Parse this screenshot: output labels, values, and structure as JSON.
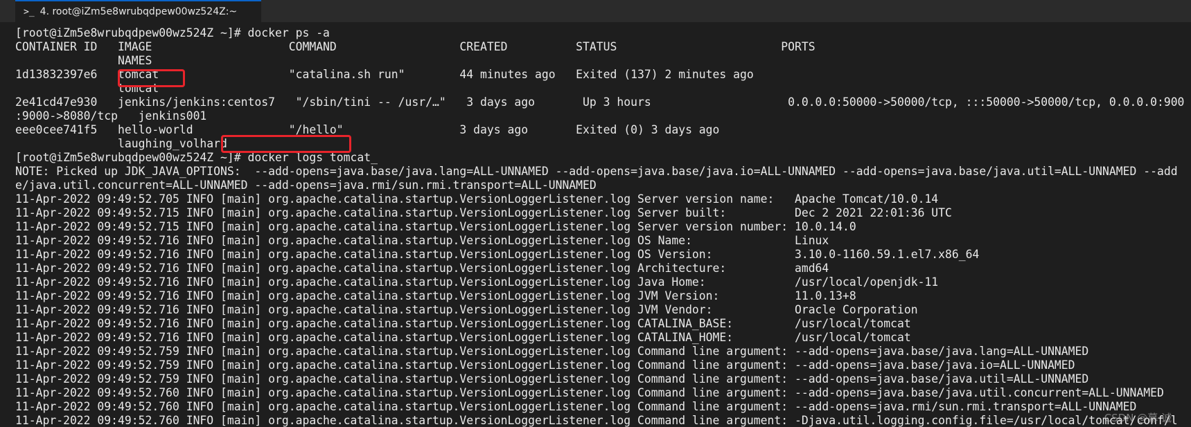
{
  "tab": {
    "icon": "terminal-prompt-icon",
    "title": "4. root@iZm5e8wrubqdpew00wz524Z:~"
  },
  "terminal": {
    "lines": [
      "[root@iZm5e8wrubqdpew00wz524Z ~]# docker ps -a",
      "CONTAINER ID   IMAGE                    COMMAND                  CREATED          STATUS                        PORTS",
      "               NAMES",
      "1d13832397e6   tomcat                   \"catalina.sh run\"        44 minutes ago   Exited (137) 2 minutes ago",
      "               tomcat",
      "2e41cd47e930   jenkins/jenkins:centos7   \"/sbin/tini -- /usr/…\"   3 days ago       Up 3 hours                    0.0.0.0:50000->50000/tcp, :::50000->50000/tcp, 0.0.0.0:900",
      ":9000->8080/tcp   jenkins001",
      "eee0cee741f5   hello-world              \"/hello\"                 3 days ago       Exited (0) 3 days ago",
      "               laughing_volhard",
      "[root@iZm5e8wrubqdpew00wz524Z ~]# docker logs tomcat_",
      "NOTE: Picked up JDK_JAVA_OPTIONS:  --add-opens=java.base/java.lang=ALL-UNNAMED --add-opens=java.base/java.io=ALL-UNNAMED --add-opens=java.base/java.util=ALL-UNNAMED --add",
      "e/java.util.concurrent=ALL-UNNAMED --add-opens=java.rmi/sun.rmi.transport=ALL-UNNAMED",
      "11-Apr-2022 09:49:52.705 INFO [main] org.apache.catalina.startup.VersionLoggerListener.log Server version name:   Apache Tomcat/10.0.14",
      "11-Apr-2022 09:49:52.715 INFO [main] org.apache.catalina.startup.VersionLoggerListener.log Server built:          Dec 2 2021 22:01:36 UTC",
      "11-Apr-2022 09:49:52.715 INFO [main] org.apache.catalina.startup.VersionLoggerListener.log Server version number: 10.0.14.0",
      "11-Apr-2022 09:49:52.716 INFO [main] org.apache.catalina.startup.VersionLoggerListener.log OS Name:               Linux",
      "11-Apr-2022 09:49:52.716 INFO [main] org.apache.catalina.startup.VersionLoggerListener.log OS Version:            3.10.0-1160.59.1.el7.x86_64",
      "11-Apr-2022 09:49:52.716 INFO [main] org.apache.catalina.startup.VersionLoggerListener.log Architecture:          amd64",
      "11-Apr-2022 09:49:52.716 INFO [main] org.apache.catalina.startup.VersionLoggerListener.log Java Home:             /usr/local/openjdk-11",
      "11-Apr-2022 09:49:52.716 INFO [main] org.apache.catalina.startup.VersionLoggerListener.log JVM Version:           11.0.13+8",
      "11-Apr-2022 09:49:52.716 INFO [main] org.apache.catalina.startup.VersionLoggerListener.log JVM Vendor:            Oracle Corporation",
      "11-Apr-2022 09:49:52.716 INFO [main] org.apache.catalina.startup.VersionLoggerListener.log CATALINA_BASE:         /usr/local/tomcat",
      "11-Apr-2022 09:49:52.716 INFO [main] org.apache.catalina.startup.VersionLoggerListener.log CATALINA_HOME:         /usr/local/tomcat",
      "11-Apr-2022 09:49:52.759 INFO [main] org.apache.catalina.startup.VersionLoggerListener.log Command line argument: --add-opens=java.base/java.lang=ALL-UNNAMED",
      "11-Apr-2022 09:49:52.759 INFO [main] org.apache.catalina.startup.VersionLoggerListener.log Command line argument: --add-opens=java.base/java.io=ALL-UNNAMED",
      "11-Apr-2022 09:49:52.759 INFO [main] org.apache.catalina.startup.VersionLoggerListener.log Command line argument: --add-opens=java.base/java.util=ALL-UNNAMED",
      "11-Apr-2022 09:49:52.760 INFO [main] org.apache.catalina.startup.VersionLoggerListener.log Command line argument: --add-opens=java.base/java.util.concurrent=ALL-UNNAMED",
      "11-Apr-2022 09:49:52.760 INFO [main] org.apache.catalina.startup.VersionLoggerListener.log Command line argument: --add-opens=java.rmi/sun.rmi.transport=ALL-UNNAMED",
      "11-Apr-2022 09:49:52.760 INFO [main] org.apache.catalina.startup.VersionLoggerListener.log Command line argument: -Djava.util.logging.config.file=/usr/local/tomcat/conf/l"
    ]
  },
  "watermark": "CSDN @幕    诚",
  "colors": {
    "background": "#1e1e1e",
    "text": "#e8e8e8",
    "highlight": "#e8242b",
    "tab_accent": "#0a63c9"
  }
}
